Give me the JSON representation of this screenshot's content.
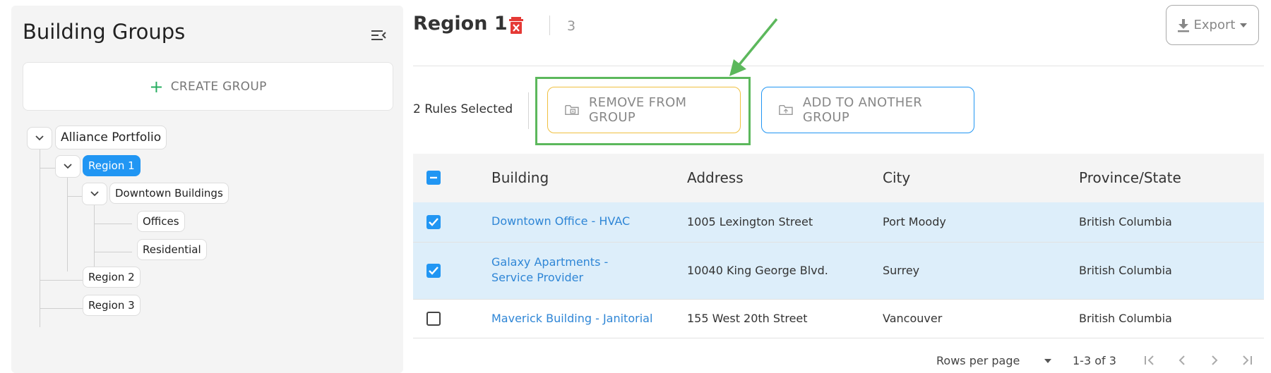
{
  "sidebar": {
    "title": "Building Groups",
    "create_label": "CREATE GROUP",
    "tree": {
      "root": "Alliance Portfolio",
      "region1": "Region 1",
      "downtown": "Downtown Buildings",
      "offices": "Offices",
      "residential": "Residential",
      "region2": "Region 2",
      "region3": "Region 3"
    }
  },
  "header": {
    "title": "Region 1",
    "count": "3",
    "export_label": "Export"
  },
  "actions": {
    "selected_text": "2 Rules Selected",
    "remove_label": "REMOVE FROM GROUP",
    "add_label": "ADD TO ANOTHER GROUP"
  },
  "table": {
    "columns": [
      "Building",
      "Address",
      "City",
      "Province/State"
    ],
    "rows": [
      {
        "building": "Downtown Office - HVAC",
        "address": "1005 Lexington Street",
        "city": "Port Moody",
        "province": "British Columbia",
        "checked": true
      },
      {
        "building": "Galaxy Apartments - Service Provider",
        "address": "10040 King George Blvd.",
        "city": "Surrey",
        "province": "British Columbia",
        "checked": true
      },
      {
        "building": "Maverick Building - Janitorial",
        "address": "155 West 20th Street",
        "city": "Vancouver",
        "province": "British Columbia",
        "checked": false
      }
    ]
  },
  "footer": {
    "rows_per_page_label": "Rows per page",
    "range": "1-3 of 3"
  },
  "colors": {
    "accent": "#2196f3",
    "highlight": "#5cb85c",
    "remove_border": "#f0c040",
    "danger": "#e53935"
  }
}
